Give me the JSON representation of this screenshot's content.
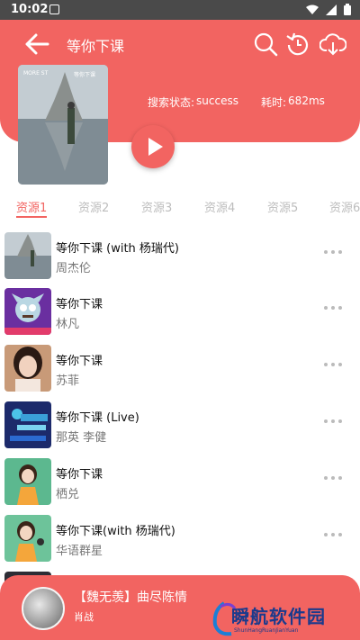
{
  "status_bar": {
    "time": "10:02"
  },
  "header": {
    "title": "等你下课",
    "search_status_label": "搜索状态:",
    "search_status_value": "success",
    "elapsed_label": "耗时:",
    "elapsed_value": "682ms",
    "cover_text_left": "MORE ST",
    "cover_text_right": "等你下课"
  },
  "tabs": [
    "资源1",
    "资源2",
    "资源3",
    "资源4",
    "资源5",
    "资源6"
  ],
  "active_tab": 0,
  "songs": [
    {
      "title": "等你下课 (with 杨瑞代)",
      "artist": "周杰伦"
    },
    {
      "title": "等你下课",
      "artist": "林凡"
    },
    {
      "title": "等你下课",
      "artist": "苏菲"
    },
    {
      "title": "等你下课 (Live)",
      "artist": "那英  李健"
    },
    {
      "title": "等你下课",
      "artist": "栖兑"
    },
    {
      "title": "等你下课(with 杨瑞代)",
      "artist": "华语群星"
    }
  ],
  "player": {
    "title": "【魏无羡】曲尽陈情",
    "artist": "肖战"
  },
  "watermark": {
    "text": "瞬航软件园",
    "sub": "ShunHangRuanJianYuan"
  },
  "colors": {
    "accent": "#f26461",
    "status_bar": "#4a4a4a",
    "watermark": "#1b3a8c"
  }
}
